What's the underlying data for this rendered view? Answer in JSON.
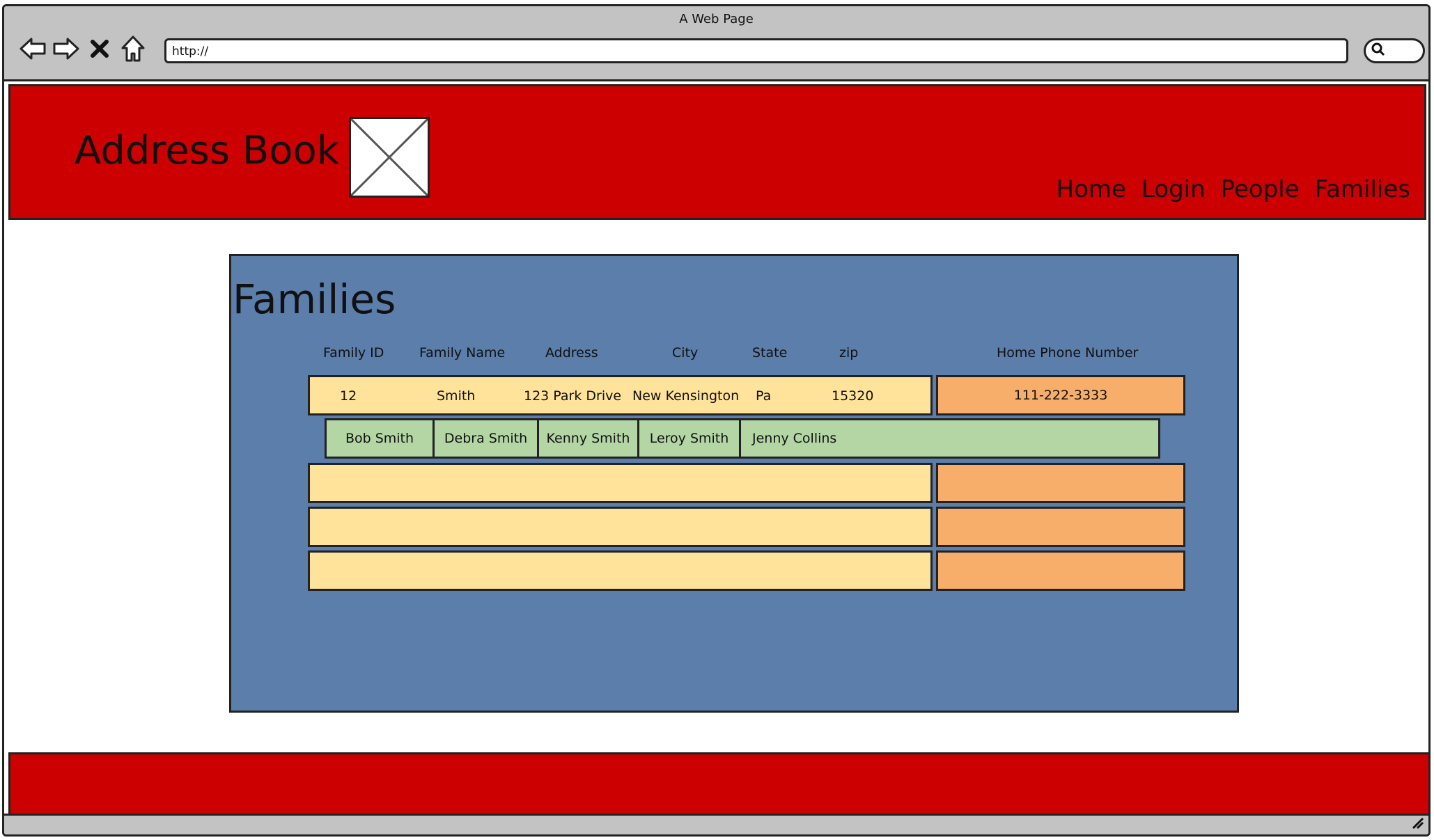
{
  "browser": {
    "window_title": "A Web Page",
    "url": "http://",
    "icons": [
      "back-icon",
      "forward-icon",
      "stop-icon",
      "home-icon",
      "search-icon"
    ]
  },
  "header": {
    "title": "Address Book",
    "nav": [
      "Home",
      "Login",
      "People",
      "Families"
    ]
  },
  "main": {
    "title": "Families",
    "columns": [
      "Family ID",
      "Family Name",
      "Address",
      "City",
      "State",
      "zip",
      "Home Phone Number"
    ],
    "families": [
      {
        "id": "12",
        "name": "Smith",
        "address": "123 Park Drive",
        "city": "New Kensington",
        "state": "Pa",
        "zip": "15320",
        "phone": "111-222-3333",
        "members": [
          "Bob Smith",
          "Debra Smith",
          "Kenny Smith",
          "Leroy Smith",
          "Jenny Collins"
        ]
      }
    ]
  },
  "colors": {
    "header": "#cc0000",
    "panel": "#5b7eab",
    "row": "#ffe39a",
    "phone": "#f6ae6a",
    "members": "#b3d6a4",
    "chrome": "#c3c3c3"
  }
}
